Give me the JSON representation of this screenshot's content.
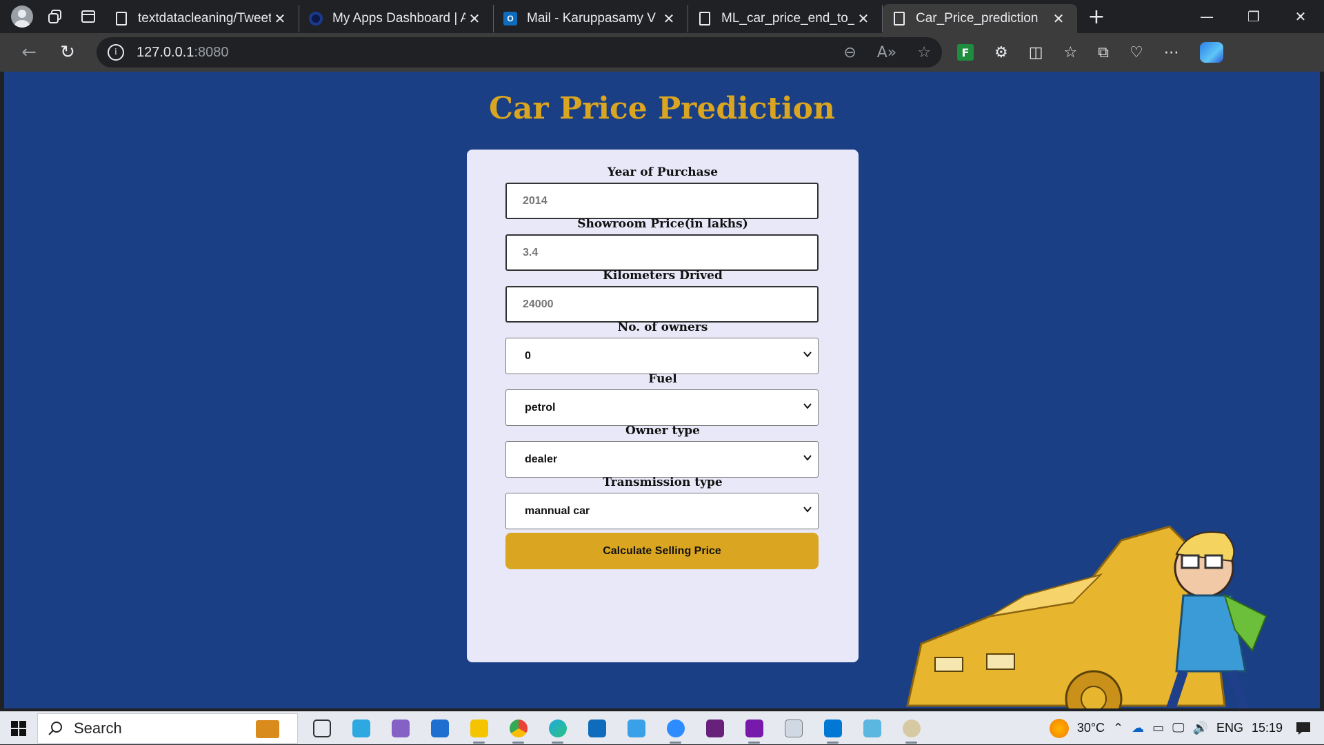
{
  "browser": {
    "tabs": [
      {
        "title": "textdatacleaning/Tweets",
        "favicon": "document-icon"
      },
      {
        "title": "My Apps Dashboard | Ac",
        "favicon": "okta-ring-icon"
      },
      {
        "title": "Mail - Karuppasamy V",
        "favicon": "outlook-icon"
      },
      {
        "title": "ML_car_price_end_to_end",
        "favicon": "document-icon"
      },
      {
        "title": "Car_Price_prediction",
        "favicon": "document-icon",
        "active": true
      }
    ],
    "url_host": "127.0.0.1",
    "url_port": ":8080"
  },
  "page": {
    "title": "Car Price Prediction",
    "fields": {
      "year": {
        "label": "Year of Purchase",
        "placeholder": "2014"
      },
      "price": {
        "label": "Showroom Price(in lakhs)",
        "placeholder": "3.4"
      },
      "kms": {
        "label": "Kilometers Drived",
        "placeholder": "24000"
      },
      "owners": {
        "label": "No. of owners",
        "selected": "0"
      },
      "fuel": {
        "label": "Fuel",
        "selected": "petrol"
      },
      "owner_type": {
        "label": "Owner type",
        "selected": "dealer"
      },
      "transmission": {
        "label": "Transmission type",
        "selected": "mannual car"
      }
    },
    "submit_label": "Calculate Selling Price"
  },
  "taskbar": {
    "search_text": "Search",
    "weather": "30°C",
    "language": "ENG",
    "time": "15:19"
  },
  "colors": {
    "page_background": "#1a3f85",
    "title_gold": "#daa520",
    "card_background": "#e8e8f8",
    "button_gold": "#daa520"
  }
}
